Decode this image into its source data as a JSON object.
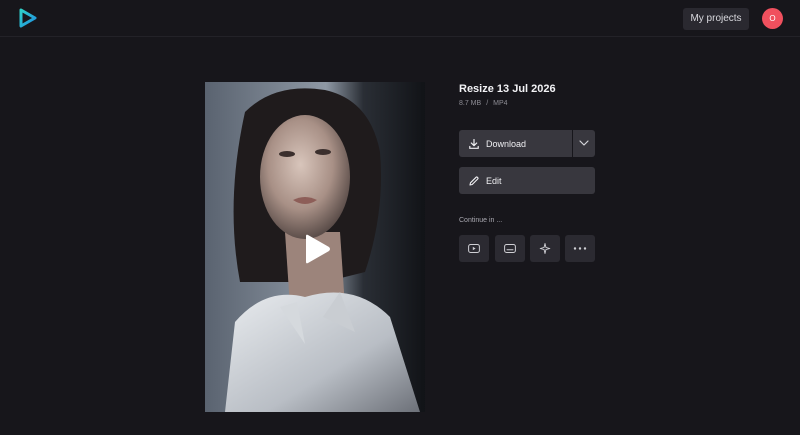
{
  "header": {
    "logo_icon": "play-logo-icon",
    "my_projects_label": "My projects",
    "avatar_initial": "O",
    "avatar_color": "#f0505e"
  },
  "preview": {
    "play_icon": "play-icon"
  },
  "file": {
    "title": "Resize 13 Jul 2026",
    "size": "8.7 MB",
    "separator": "/",
    "format": "MP4"
  },
  "actions": {
    "download_label": "Download",
    "download_icon": "download-icon",
    "dropdown_icon": "chevron-down-icon",
    "edit_label": "Edit",
    "edit_icon": "pencil-icon"
  },
  "continue_in": {
    "label": "Continue in ...",
    "apps": [
      {
        "icon": "youtube-icon"
      },
      {
        "icon": "subtitles-icon"
      },
      {
        "icon": "sparkle-icon"
      },
      {
        "icon": "more-icon"
      }
    ]
  },
  "colors": {
    "background": "#17161b",
    "button": "#38373e",
    "accent_logo": "#1fb4d8"
  }
}
